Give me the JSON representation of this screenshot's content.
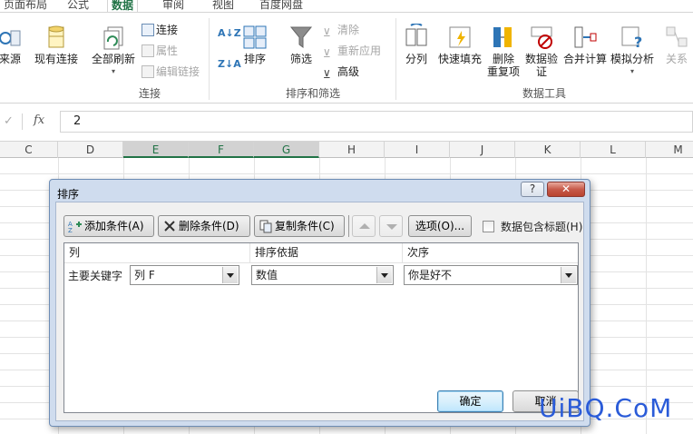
{
  "ribbon_tabs": [
    "页面布局",
    "公式",
    "数据",
    "审阅",
    "视图",
    "百度网盘"
  ],
  "active_tab": "数据",
  "ribbon": {
    "from_source": "来源",
    "existing_connections": "现有连接",
    "refresh_all": "全部刷新",
    "connections": "连接",
    "properties": "属性",
    "edit_links": "编辑链接",
    "group_connections": "连接",
    "sort_asc": "A↓Z",
    "sort_desc": "Z↓A",
    "sort": "排序",
    "filter": "筛选",
    "clear": "清除",
    "reapply": "重新应用",
    "advanced": "高级",
    "group_sort_filter": "排序和筛选",
    "text_to_columns": "分列",
    "flash_fill": "快速填充",
    "remove_dup_line1": "删除",
    "remove_dup_line2": "重复项",
    "data_validation_line1": "数据验",
    "data_validation_line2": "证",
    "consolidate": "合并计算",
    "what_if": "模拟分析",
    "relationships": "关系",
    "group_data_tools": "数据工具"
  },
  "formula_bar": {
    "check": "✓",
    "fx": "fx",
    "value": "2"
  },
  "columns": [
    {
      "label": "C",
      "selected": false
    },
    {
      "label": "D",
      "selected": false
    },
    {
      "label": "E",
      "selected": true
    },
    {
      "label": "F",
      "selected": true
    },
    {
      "label": "G",
      "selected": true
    },
    {
      "label": "H",
      "selected": false
    },
    {
      "label": "I",
      "selected": false
    },
    {
      "label": "J",
      "selected": false
    },
    {
      "label": "K",
      "selected": false
    },
    {
      "label": "L",
      "selected": false
    },
    {
      "label": "M",
      "selected": false
    }
  ],
  "dialog": {
    "title": "排序",
    "help": "?",
    "close": "✕",
    "add_level": "添加条件(A)",
    "delete_level": "删除条件(D)",
    "copy_level": "复制条件(C)",
    "options": "选项(O)...",
    "has_headers": "数据包含标题(H)",
    "has_headers_checked": false,
    "col_header_column": "列",
    "col_header_sort_on": "排序依据",
    "col_header_order": "次序",
    "row_label": "主要关键字",
    "column_value": "列 F",
    "sort_on_value": "数值",
    "order_value": "你是好不",
    "ok": "确定",
    "cancel": "取消"
  },
  "watermark": "UiBQ.CoM",
  "colors": {
    "accent": "#217346",
    "watermark": "#2a5bd8"
  }
}
